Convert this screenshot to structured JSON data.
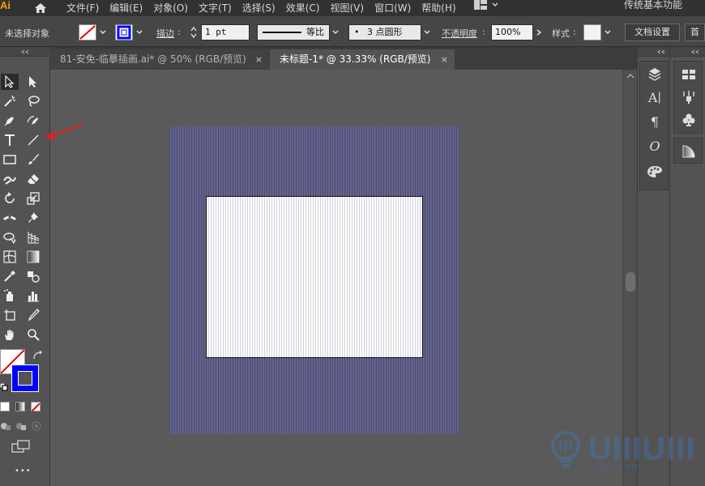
{
  "app": {
    "logo": "Ai",
    "menu": [
      "文件(F)",
      "编辑(E)",
      "对象(O)",
      "文字(T)",
      "选择(S)",
      "效果(C)",
      "视图(V)",
      "窗口(W)",
      "帮助(H)"
    ],
    "workspace": "传统基本功能"
  },
  "control_bar": {
    "selection_status": "未选择对象",
    "stroke_label": "描边",
    "stroke_value": "1 pt",
    "stroke_profile": "等比",
    "brush_preset": "3 点圆形",
    "brush_dot": "•",
    "opacity_label": "不透明度",
    "opacity_value": "100%",
    "style_label": "样式",
    "doc_setup_button": "文档设置",
    "prefs_button": "首",
    "fill_color": "#ffffff",
    "stroke_color": "#0000ff",
    "colon": ":"
  },
  "tabs": [
    {
      "label": "81-安免-临摹插画.ai* @ 50% (RGB/预览)",
      "close": "×",
      "active": false
    },
    {
      "label": "未标题-1* @ 33.33% (RGB/预览)",
      "close": "×",
      "active": true
    }
  ],
  "toolbar": {
    "tools": [
      "selection-tool",
      "direct-selection-tool",
      "magic-wand-tool",
      "lasso-tool",
      "pen-tool",
      "curvature-tool",
      "type-tool",
      "line-segment-tool",
      "rectangle-tool",
      "paintbrush-tool",
      "shaper-tool",
      "eraser-tool",
      "rotate-tool",
      "scale-tool",
      "width-tool",
      "puppet-warp-tool",
      "shape-builder-tool",
      "perspective-grid-tool",
      "mesh-tool",
      "gradient-tool",
      "eyedropper-tool",
      "blend-tool",
      "symbol-sprayer-tool",
      "column-graph-tool",
      "artboard-tool",
      "slice-tool",
      "hand-tool",
      "zoom-tool"
    ],
    "fill_color": "#ffffff",
    "stroke_color": "#0000ff",
    "more": "•••"
  },
  "artboard": {
    "pattern_color": "#4e4e78",
    "background": "#ffffff"
  },
  "panels": {
    "character_glyph": "A",
    "paragraph_glyph": "¶",
    "opentype_glyph": "O"
  },
  "annotation": {
    "arrow_color": "#e02020"
  },
  "watermark": {
    "text": "UIIIUIII",
    "sub": "UI设计自学网"
  }
}
